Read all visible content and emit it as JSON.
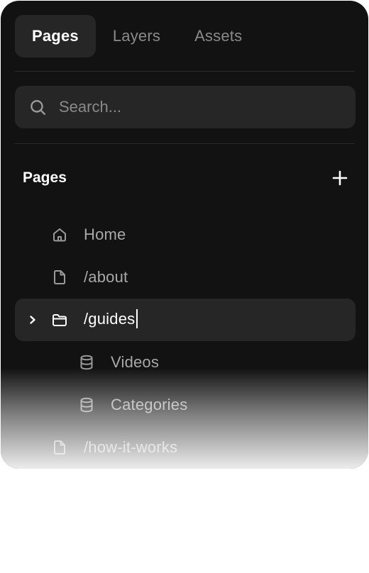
{
  "tabs": [
    {
      "label": "Pages",
      "active": true
    },
    {
      "label": "Layers",
      "active": false
    },
    {
      "label": "Assets",
      "active": false
    }
  ],
  "search": {
    "placeholder": "Search...",
    "value": "",
    "icon": "search-icon"
  },
  "section": {
    "title": "Pages",
    "add_icon": "plus-icon"
  },
  "tree": {
    "items": [
      {
        "label": "Home",
        "icon": "home-icon"
      },
      {
        "label": "/about",
        "icon": "file-icon"
      },
      {
        "label": "/guides",
        "icon": "folder-icon",
        "selected": true,
        "editing": true,
        "expand_icon": "chevron-right-icon"
      },
      {
        "label": "Videos",
        "icon": "database-icon"
      },
      {
        "label": "Categories",
        "icon": "database-icon"
      },
      {
        "label": "/how-it-works",
        "icon": "file-icon"
      }
    ]
  },
  "colors": {
    "panel_bg": "#121212",
    "active_bg": "#262626",
    "text_primary": "#ffffff",
    "text_muted": "#a8a8a8"
  }
}
